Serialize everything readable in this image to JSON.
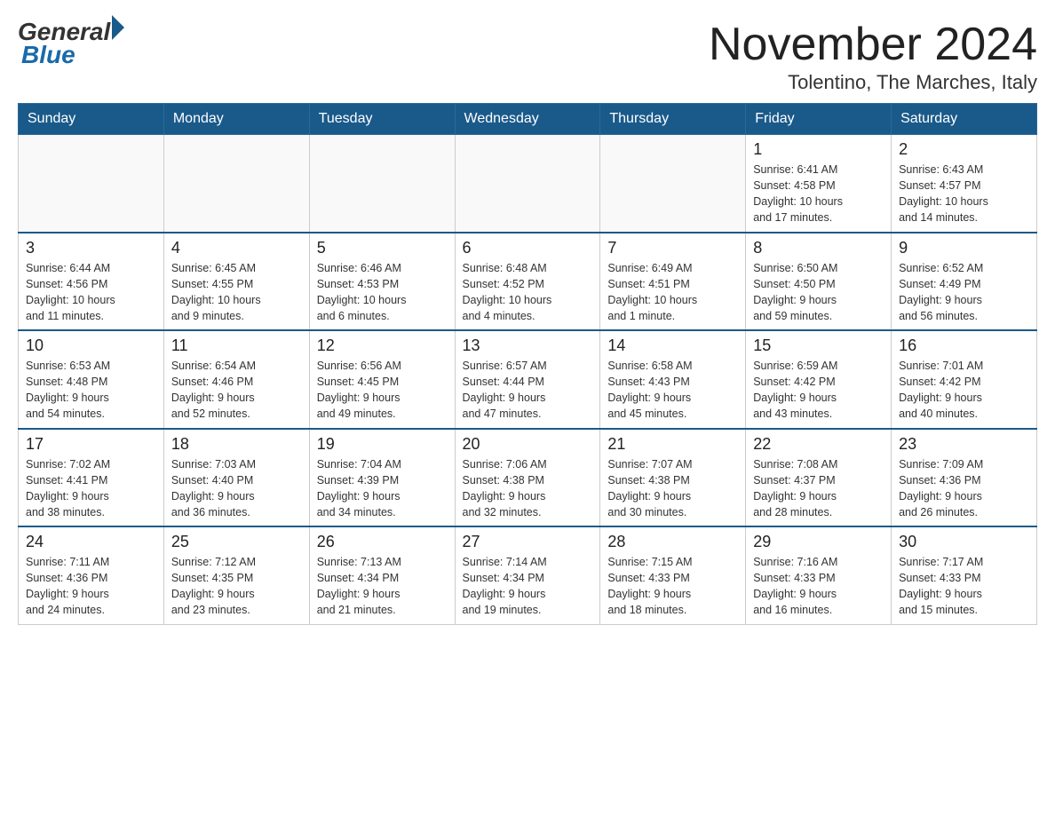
{
  "logo": {
    "general": "General",
    "blue": "Blue"
  },
  "title": "November 2024",
  "location": "Tolentino, The Marches, Italy",
  "weekdays": [
    "Sunday",
    "Monday",
    "Tuesday",
    "Wednesday",
    "Thursday",
    "Friday",
    "Saturday"
  ],
  "weeks": [
    [
      {
        "day": "",
        "info": ""
      },
      {
        "day": "",
        "info": ""
      },
      {
        "day": "",
        "info": ""
      },
      {
        "day": "",
        "info": ""
      },
      {
        "day": "",
        "info": ""
      },
      {
        "day": "1",
        "info": "Sunrise: 6:41 AM\nSunset: 4:58 PM\nDaylight: 10 hours\nand 17 minutes."
      },
      {
        "day": "2",
        "info": "Sunrise: 6:43 AM\nSunset: 4:57 PM\nDaylight: 10 hours\nand 14 minutes."
      }
    ],
    [
      {
        "day": "3",
        "info": "Sunrise: 6:44 AM\nSunset: 4:56 PM\nDaylight: 10 hours\nand 11 minutes."
      },
      {
        "day": "4",
        "info": "Sunrise: 6:45 AM\nSunset: 4:55 PM\nDaylight: 10 hours\nand 9 minutes."
      },
      {
        "day": "5",
        "info": "Sunrise: 6:46 AM\nSunset: 4:53 PM\nDaylight: 10 hours\nand 6 minutes."
      },
      {
        "day": "6",
        "info": "Sunrise: 6:48 AM\nSunset: 4:52 PM\nDaylight: 10 hours\nand 4 minutes."
      },
      {
        "day": "7",
        "info": "Sunrise: 6:49 AM\nSunset: 4:51 PM\nDaylight: 10 hours\nand 1 minute."
      },
      {
        "day": "8",
        "info": "Sunrise: 6:50 AM\nSunset: 4:50 PM\nDaylight: 9 hours\nand 59 minutes."
      },
      {
        "day": "9",
        "info": "Sunrise: 6:52 AM\nSunset: 4:49 PM\nDaylight: 9 hours\nand 56 minutes."
      }
    ],
    [
      {
        "day": "10",
        "info": "Sunrise: 6:53 AM\nSunset: 4:48 PM\nDaylight: 9 hours\nand 54 minutes."
      },
      {
        "day": "11",
        "info": "Sunrise: 6:54 AM\nSunset: 4:46 PM\nDaylight: 9 hours\nand 52 minutes."
      },
      {
        "day": "12",
        "info": "Sunrise: 6:56 AM\nSunset: 4:45 PM\nDaylight: 9 hours\nand 49 minutes."
      },
      {
        "day": "13",
        "info": "Sunrise: 6:57 AM\nSunset: 4:44 PM\nDaylight: 9 hours\nand 47 minutes."
      },
      {
        "day": "14",
        "info": "Sunrise: 6:58 AM\nSunset: 4:43 PM\nDaylight: 9 hours\nand 45 minutes."
      },
      {
        "day": "15",
        "info": "Sunrise: 6:59 AM\nSunset: 4:42 PM\nDaylight: 9 hours\nand 43 minutes."
      },
      {
        "day": "16",
        "info": "Sunrise: 7:01 AM\nSunset: 4:42 PM\nDaylight: 9 hours\nand 40 minutes."
      }
    ],
    [
      {
        "day": "17",
        "info": "Sunrise: 7:02 AM\nSunset: 4:41 PM\nDaylight: 9 hours\nand 38 minutes."
      },
      {
        "day": "18",
        "info": "Sunrise: 7:03 AM\nSunset: 4:40 PM\nDaylight: 9 hours\nand 36 minutes."
      },
      {
        "day": "19",
        "info": "Sunrise: 7:04 AM\nSunset: 4:39 PM\nDaylight: 9 hours\nand 34 minutes."
      },
      {
        "day": "20",
        "info": "Sunrise: 7:06 AM\nSunset: 4:38 PM\nDaylight: 9 hours\nand 32 minutes."
      },
      {
        "day": "21",
        "info": "Sunrise: 7:07 AM\nSunset: 4:38 PM\nDaylight: 9 hours\nand 30 minutes."
      },
      {
        "day": "22",
        "info": "Sunrise: 7:08 AM\nSunset: 4:37 PM\nDaylight: 9 hours\nand 28 minutes."
      },
      {
        "day": "23",
        "info": "Sunrise: 7:09 AM\nSunset: 4:36 PM\nDaylight: 9 hours\nand 26 minutes."
      }
    ],
    [
      {
        "day": "24",
        "info": "Sunrise: 7:11 AM\nSunset: 4:36 PM\nDaylight: 9 hours\nand 24 minutes."
      },
      {
        "day": "25",
        "info": "Sunrise: 7:12 AM\nSunset: 4:35 PM\nDaylight: 9 hours\nand 23 minutes."
      },
      {
        "day": "26",
        "info": "Sunrise: 7:13 AM\nSunset: 4:34 PM\nDaylight: 9 hours\nand 21 minutes."
      },
      {
        "day": "27",
        "info": "Sunrise: 7:14 AM\nSunset: 4:34 PM\nDaylight: 9 hours\nand 19 minutes."
      },
      {
        "day": "28",
        "info": "Sunrise: 7:15 AM\nSunset: 4:33 PM\nDaylight: 9 hours\nand 18 minutes."
      },
      {
        "day": "29",
        "info": "Sunrise: 7:16 AM\nSunset: 4:33 PM\nDaylight: 9 hours\nand 16 minutes."
      },
      {
        "day": "30",
        "info": "Sunrise: 7:17 AM\nSunset: 4:33 PM\nDaylight: 9 hours\nand 15 minutes."
      }
    ]
  ]
}
